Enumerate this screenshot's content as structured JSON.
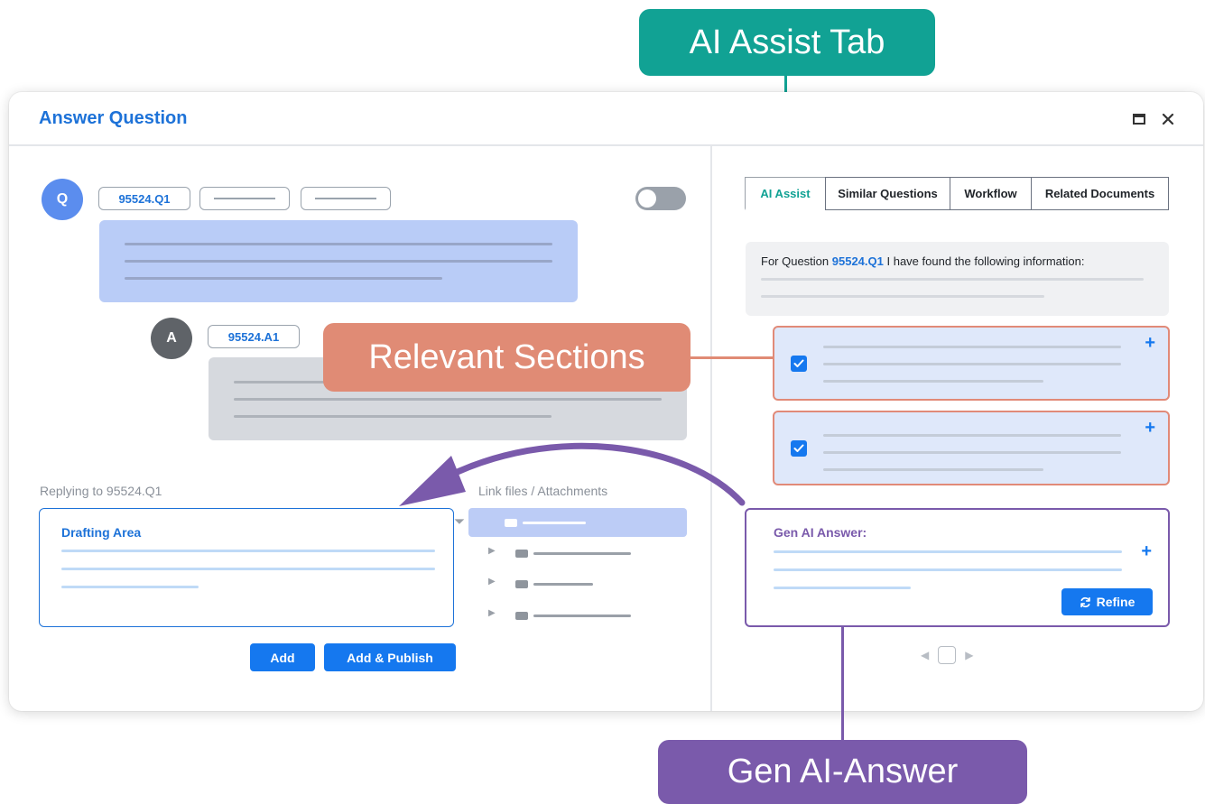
{
  "callouts": {
    "ai_assist_tab": "AI Assist Tab",
    "relevant_sections": "Relevant Sections",
    "gen_ai_answer": "Gen AI-Answer"
  },
  "window": {
    "title": "Answer Question",
    "maximize_icon": "maximize-icon",
    "close_icon": "close-icon"
  },
  "question": {
    "avatar": "Q",
    "id_pill": "95524.Q1"
  },
  "answer": {
    "avatar": "A",
    "id_pill": "95524.A1"
  },
  "reply": {
    "label": "Replying to 95524.Q1",
    "drafting_title": "Drafting Area",
    "add_button": "Add",
    "add_publish_button": "Add & Publish"
  },
  "attachments": {
    "label": "Link files / Attachments"
  },
  "tabs": [
    {
      "label": "AI Assist",
      "active": true
    },
    {
      "label": "Similar Questions",
      "active": false
    },
    {
      "label": "Workflow",
      "active": false
    },
    {
      "label": "Related Documents",
      "active": false
    }
  ],
  "info": {
    "prefix": "For Question ",
    "question_id": "95524.Q1",
    "suffix": " I have found the following information:"
  },
  "gen_answer": {
    "title": "Gen AI Answer:",
    "refine_button": "Refine"
  },
  "colors": {
    "accent_blue": "#1578ef",
    "teal": "#11a294",
    "coral": "#e08b75",
    "purple": "#7a5aab"
  }
}
